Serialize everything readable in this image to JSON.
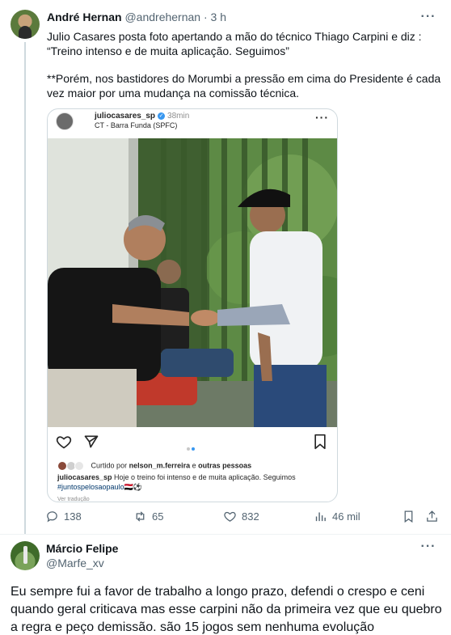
{
  "post1": {
    "author_name": "André Hernan",
    "author_handle": "@andrehernan",
    "separator": "·",
    "time": "3 h",
    "more": "···",
    "text_line1": "Julio Casares posta foto apertando a mão do técnico Thiago Carpini e diz :",
    "text_line2": "“Treino intenso e de muita aplicação. Seguimos”",
    "text_line3": "**Porém, nos bastidores do Morumbi a pressão em cima do Presidente é cada vez maior por uma mudança na comissão técnica.",
    "embed": {
      "username": "juliocasares_sp",
      "verified_mark": "✓",
      "time": "38min",
      "location": "CT - Barra Funda (SPFC)",
      "more": "···",
      "liked_by_prefix": "Curtido por ",
      "liked_by_user": "nelson_m.ferreira",
      "liked_by_middle": " e ",
      "liked_by_suffix": "outras pessoas",
      "caption_user": "juliocasares_sp",
      "caption_text": " Hoje o treino foi intenso e de muita aplicação. Seguimos ",
      "caption_tag": "#juntospelosaopaulo",
      "caption_emoji": "🇾🇪⚽",
      "translate": "Ver tradução"
    },
    "stats": {
      "replies": "138",
      "reposts": "65",
      "likes": "832",
      "views": "46 mil"
    }
  },
  "post2": {
    "author_name": "Márcio Felipe",
    "author_handle": "@Marfe_xv",
    "more": "···",
    "text": "Eu sempre fui a favor de trabalho a longo prazo, defendi o crespo e ceni quando geral criticava mas esse carpini não da primeira vez que eu quebro a regra e peço demissão. são 15 jogos sem nenhuma evolução"
  },
  "colors": {
    "text_primary": "#0f1419",
    "text_secondary": "#536471",
    "border": "#cfd9de",
    "ig_blue": "#3897f0",
    "ig_link": "#00376b"
  },
  "icons": {
    "reply": "reply-icon",
    "repost": "repost-icon",
    "like": "heart-icon",
    "views": "views-icon",
    "bookmark": "bookmark-icon",
    "share": "share-icon"
  }
}
